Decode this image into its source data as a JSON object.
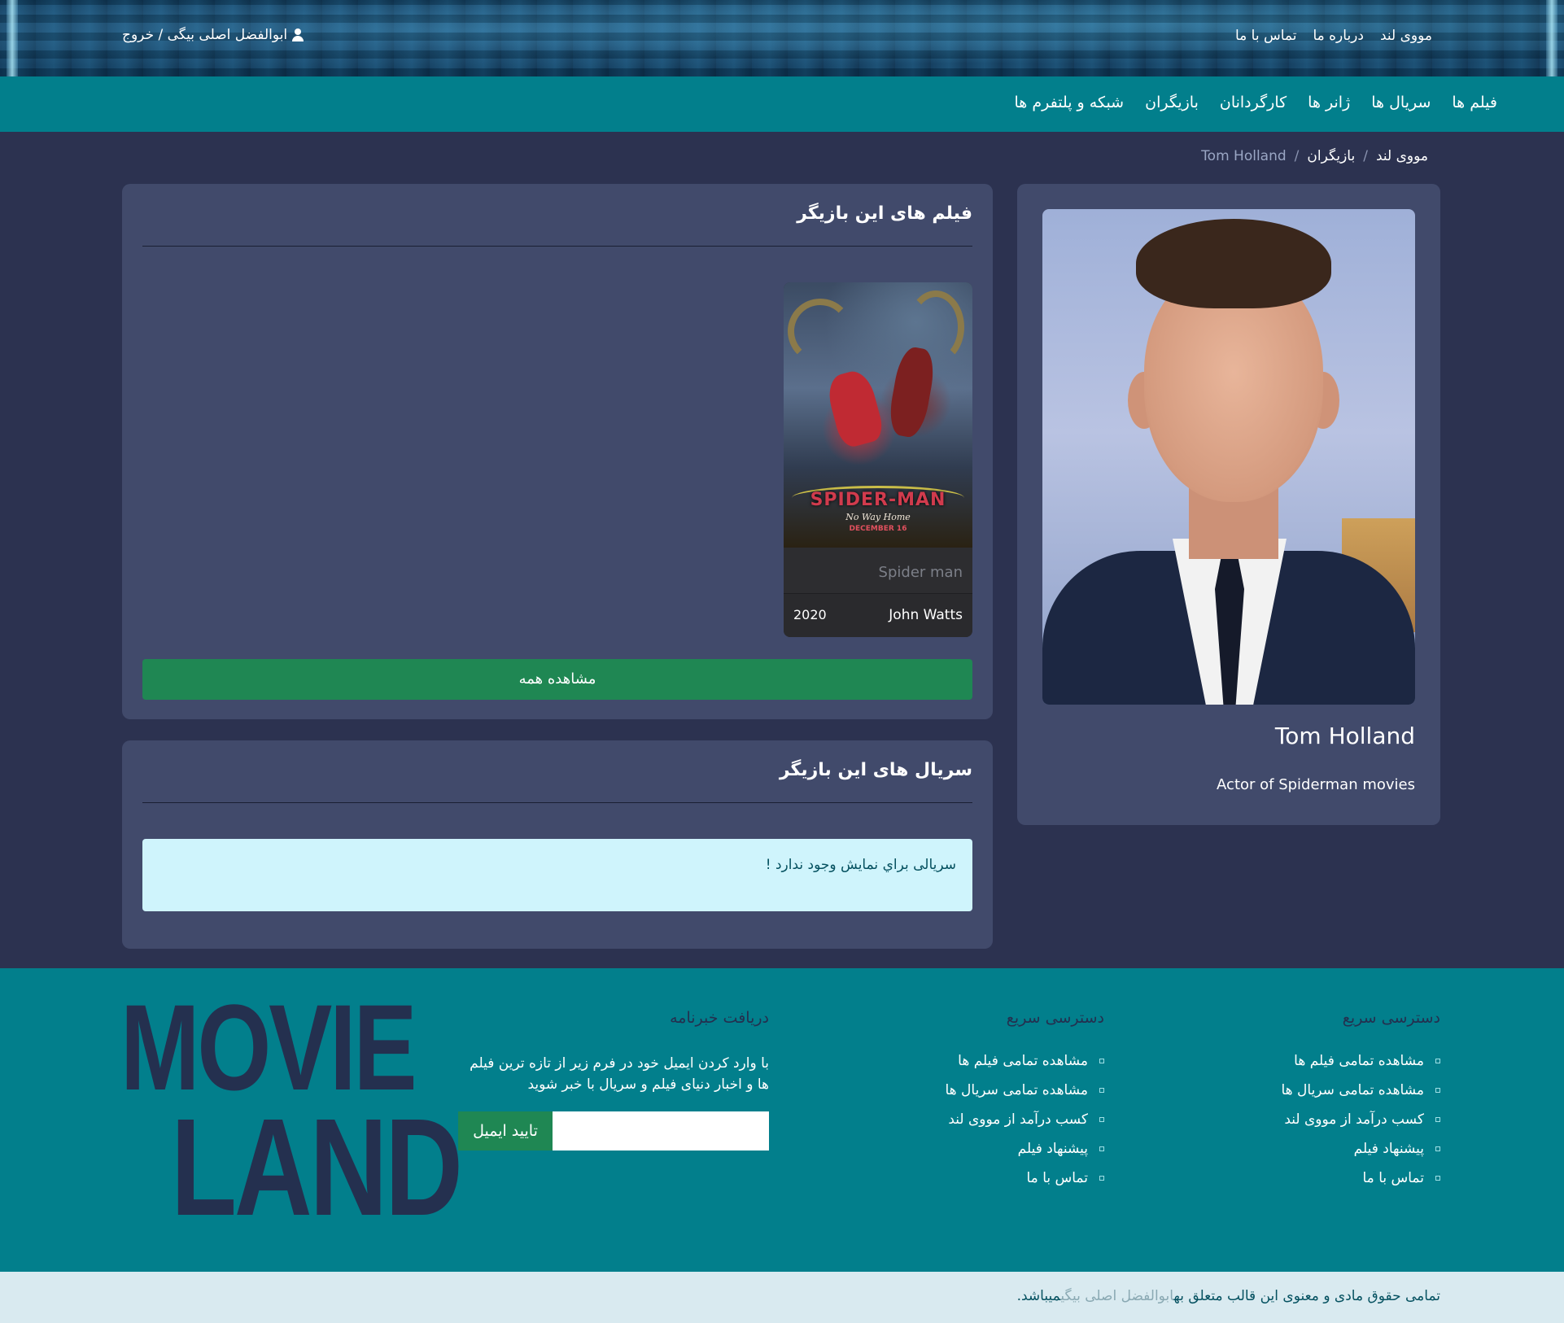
{
  "topbar": {
    "links": [
      "مووی لند",
      "درباره ما",
      "تماس با ما"
    ],
    "user_label": "ابوالفضل اصلی بیگی / خروج"
  },
  "nav": {
    "items": [
      "فیلم ها",
      "سریال ها",
      "ژانر ها",
      "کارگردانان",
      "بازیگران",
      "شبکه و پلتفرم ها"
    ]
  },
  "breadcrumb": {
    "items": [
      "مووی لند",
      "بازیگران"
    ],
    "separator": "/",
    "current": "Tom Holland"
  },
  "actor": {
    "name": "Tom Holland",
    "description": "Actor of Spiderman movies"
  },
  "movies_section": {
    "title": "فیلم های این بازیگر",
    "movies": [
      {
        "title": "Spider man",
        "director": "John Watts",
        "year": "2020",
        "poster_title": "SPIDER-MAN",
        "poster_subtitle": "No Way Home",
        "poster_date": "DECEMBER 16"
      }
    ],
    "view_all_label": "مشاهده همه"
  },
  "series_section": {
    "title": "سریال های این بازیگر",
    "empty_message": "سریالی براي نمایش وجود ندارد !"
  },
  "footer": {
    "quick_access_1": {
      "title": "دسترسی سریع",
      "links": [
        "مشاهده تمامی فیلم ها",
        "مشاهده تمامی سریال ها",
        "کسب درآمد از مووی لند",
        "پیشنهاد فیلم",
        "تماس با ما"
      ]
    },
    "quick_access_2": {
      "title": "دسترسی سریع",
      "links": [
        "مشاهده تمامی فیلم ها",
        "مشاهده تمامی سریال ها",
        "کسب درآمد از مووی لند",
        "پیشنهاد فیلم",
        "تماس با ما"
      ]
    },
    "newsletter": {
      "title": "دریافت خبرنامه",
      "description": "با وارد کردن ایمیل خود در فرم زیر از تازه ترین فیلم ها و اخبار دنیای فیلم و سریال با خبر شوید",
      "input_value": "",
      "button_label": "تایید ایمیل"
    },
    "logo": {
      "line1": "MOVIE",
      "line2": "LAND"
    }
  },
  "copyright": {
    "prefix": "تمامی حقوق مادی و معنوی این قالب متعلق به",
    "author": "ابوالفضل اصلی بیگی",
    "suffix": "میباشد."
  },
  "colors": {
    "page_bg": "#2c3250",
    "card_bg": "#414a6b",
    "teal": "#027f8c",
    "green_button": "#1f8753",
    "alert_bg": "#cff4fc",
    "logo_color": "#24304f"
  }
}
